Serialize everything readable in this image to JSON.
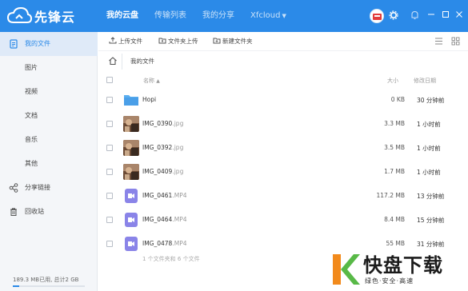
{
  "app": {
    "name": "先锋云"
  },
  "nav": {
    "items": [
      {
        "label": "我的云盘",
        "active": true
      },
      {
        "label": "传输列表",
        "active": false
      },
      {
        "label": "我的分享",
        "active": false
      },
      {
        "label": "Xfcloud",
        "active": false,
        "has_dropdown": true
      }
    ]
  },
  "topbar": {
    "icons": [
      "user-avatar",
      "gear-icon",
      "bell-icon",
      "minimize-icon",
      "maximize-icon",
      "close-icon"
    ]
  },
  "sidebar": {
    "items": [
      {
        "label": "我的文件",
        "icon": "file-icon",
        "active": true
      },
      {
        "label": "图片",
        "icon": "",
        "active": false
      },
      {
        "label": "视频",
        "icon": "",
        "active": false
      },
      {
        "label": "文档",
        "icon": "",
        "active": false
      },
      {
        "label": "音乐",
        "icon": "",
        "active": false
      },
      {
        "label": "其他",
        "icon": "",
        "active": false
      },
      {
        "label": "分享链接",
        "icon": "share-icon",
        "active": false
      },
      {
        "label": "回收站",
        "icon": "trash-icon",
        "active": false
      }
    ],
    "storage": {
      "text": "189.3 MB已用, 总计2 GB",
      "used_fraction": 0.092
    }
  },
  "toolbar": {
    "upload_label": "上传文件",
    "upload_folder_label": "文件夹上传",
    "new_folder_label": "新建文件夹"
  },
  "breadcrumb": {
    "current": "我的文件"
  },
  "table": {
    "headers": {
      "name": "名称",
      "size": "大小",
      "date": "修改日期"
    },
    "rows": [
      {
        "name": "Hopi",
        "ext": "",
        "type": "folder",
        "size": "0 KB",
        "date": "30 分钟前"
      },
      {
        "name": "IMG_0390",
        "ext": ".jpg",
        "type": "image",
        "size": "3.3 MB",
        "date": "1 小时前"
      },
      {
        "name": "IMG_0392",
        "ext": ".jpg",
        "type": "image",
        "size": "3.5 MB",
        "date": "1 小时前"
      },
      {
        "name": "IMG_0409",
        "ext": ".jpg",
        "type": "image",
        "size": "1.7 MB",
        "date": "1 小时前"
      },
      {
        "name": "IMG_0461",
        "ext": ".MP4",
        "type": "video",
        "size": "117.2 MB",
        "date": "13 分钟前"
      },
      {
        "name": "IMG_0464",
        "ext": ".MP4",
        "type": "video",
        "size": "8.4 MB",
        "date": "15 分钟前"
      },
      {
        "name": "IMG_0478",
        "ext": ".MP4",
        "type": "video",
        "size": "55 MB",
        "date": "31 分钟前"
      }
    ],
    "summary": "1 个文件夹和 6 个文件"
  },
  "watermark": {
    "title": "快盘下载",
    "subtitle": "绿色·安全·高速"
  }
}
